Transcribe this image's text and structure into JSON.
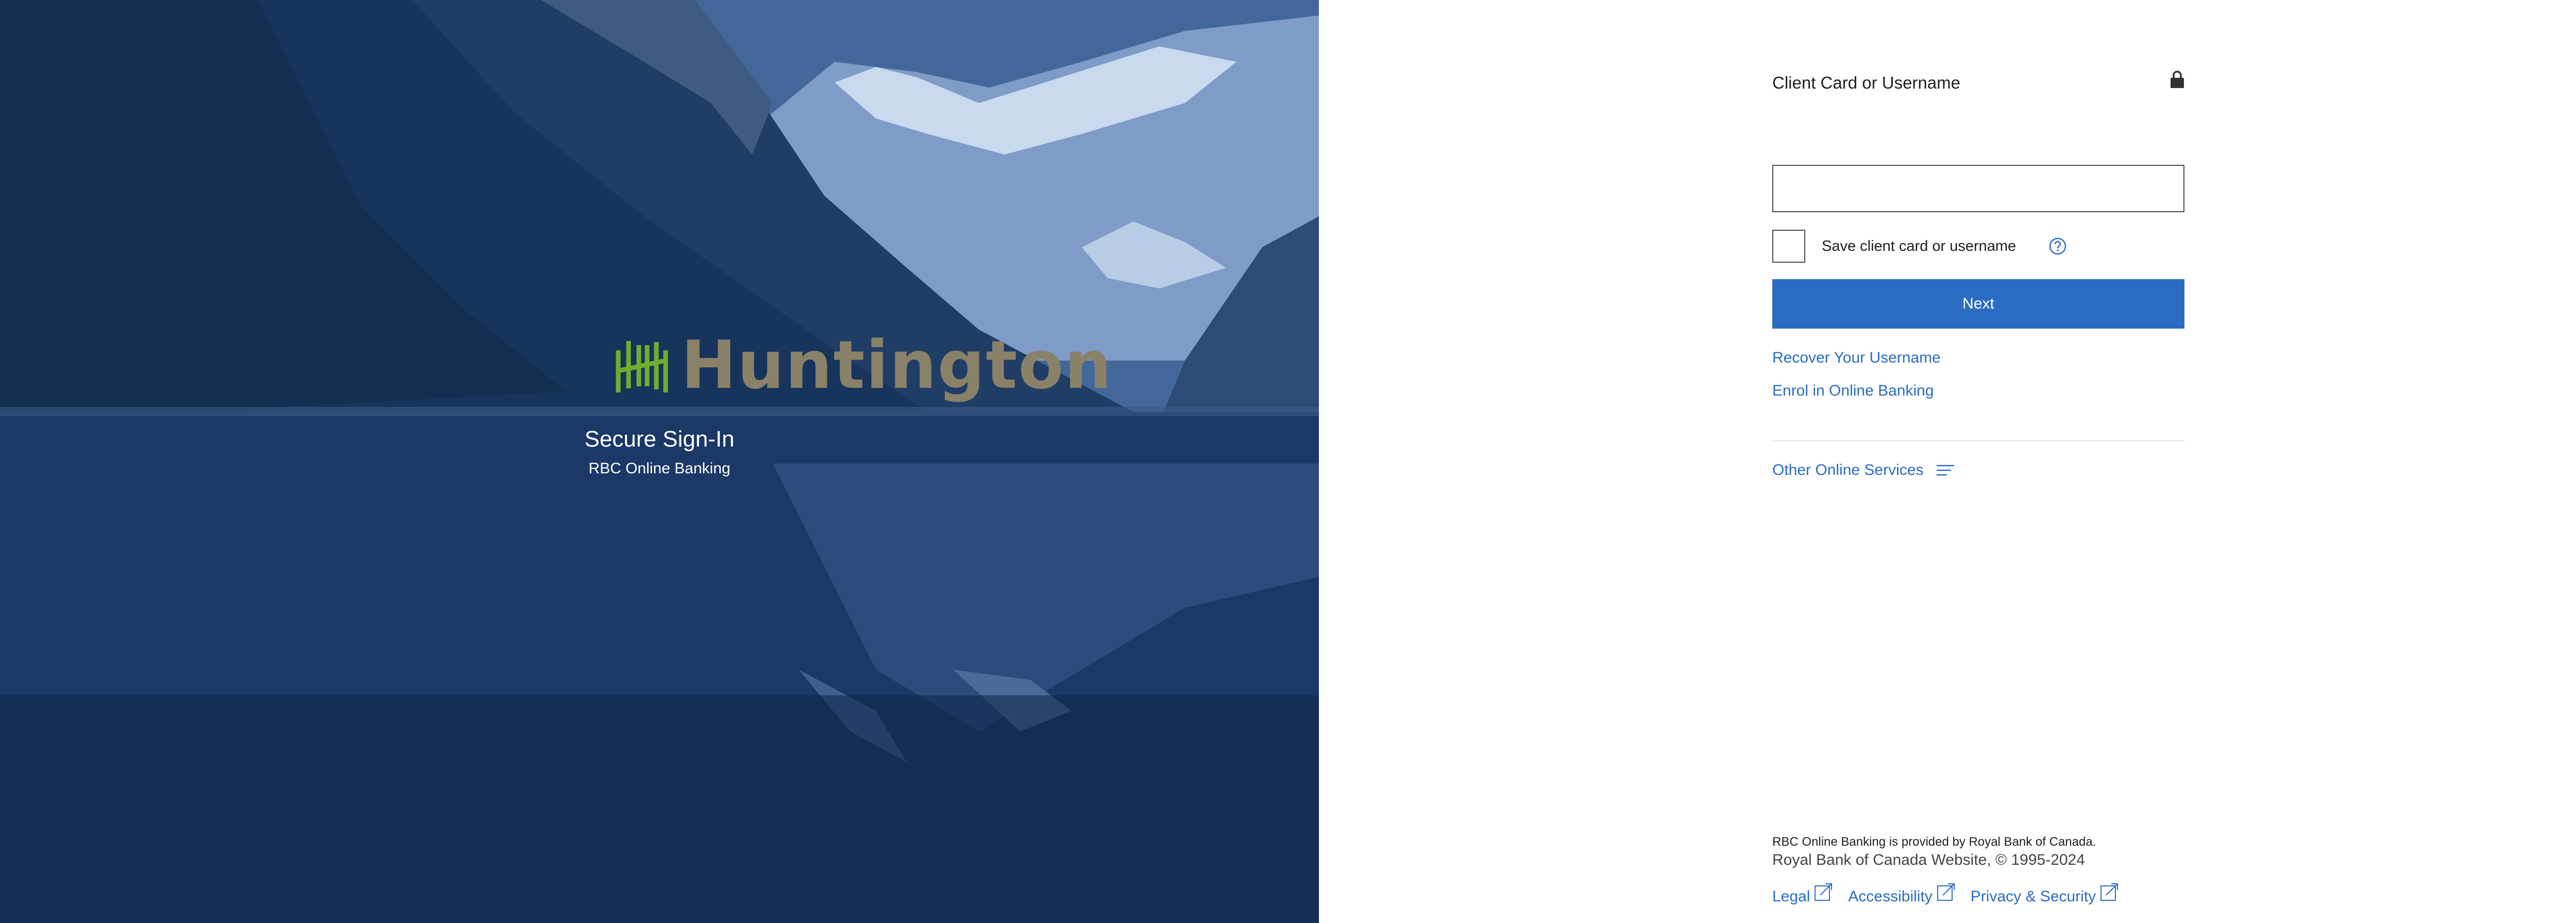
{
  "brand": {
    "name": "Huntington",
    "mark_color": "#6fae2f",
    "word_color": "#8a8169"
  },
  "hero": {
    "title": "Secure Sign-In",
    "subtitle": "RBC Online Banking"
  },
  "form": {
    "field_label": "Client Card or Username",
    "input_value": "",
    "input_placeholder": "",
    "save_label": "Save client card or username",
    "save_checked": false,
    "next_label": "Next",
    "recover_link": "Recover Your Username",
    "enrol_link": "Enrol in Online Banking",
    "other_services": "Other Online Services"
  },
  "footer": {
    "provided_by": "RBC Online Banking is provided by Royal Bank of Canada.",
    "copyright": "Royal Bank of Canada Website, © 1995-2024",
    "links": [
      "Legal",
      "Accessibility",
      "Privacy & Security"
    ]
  },
  "colors": {
    "accent": "#2a6cc2",
    "text": "#1f1f1f"
  },
  "icons": {
    "lock": "lock-icon",
    "help": "help-icon",
    "menu": "menu-lines-icon",
    "external": "external-link-icon"
  }
}
